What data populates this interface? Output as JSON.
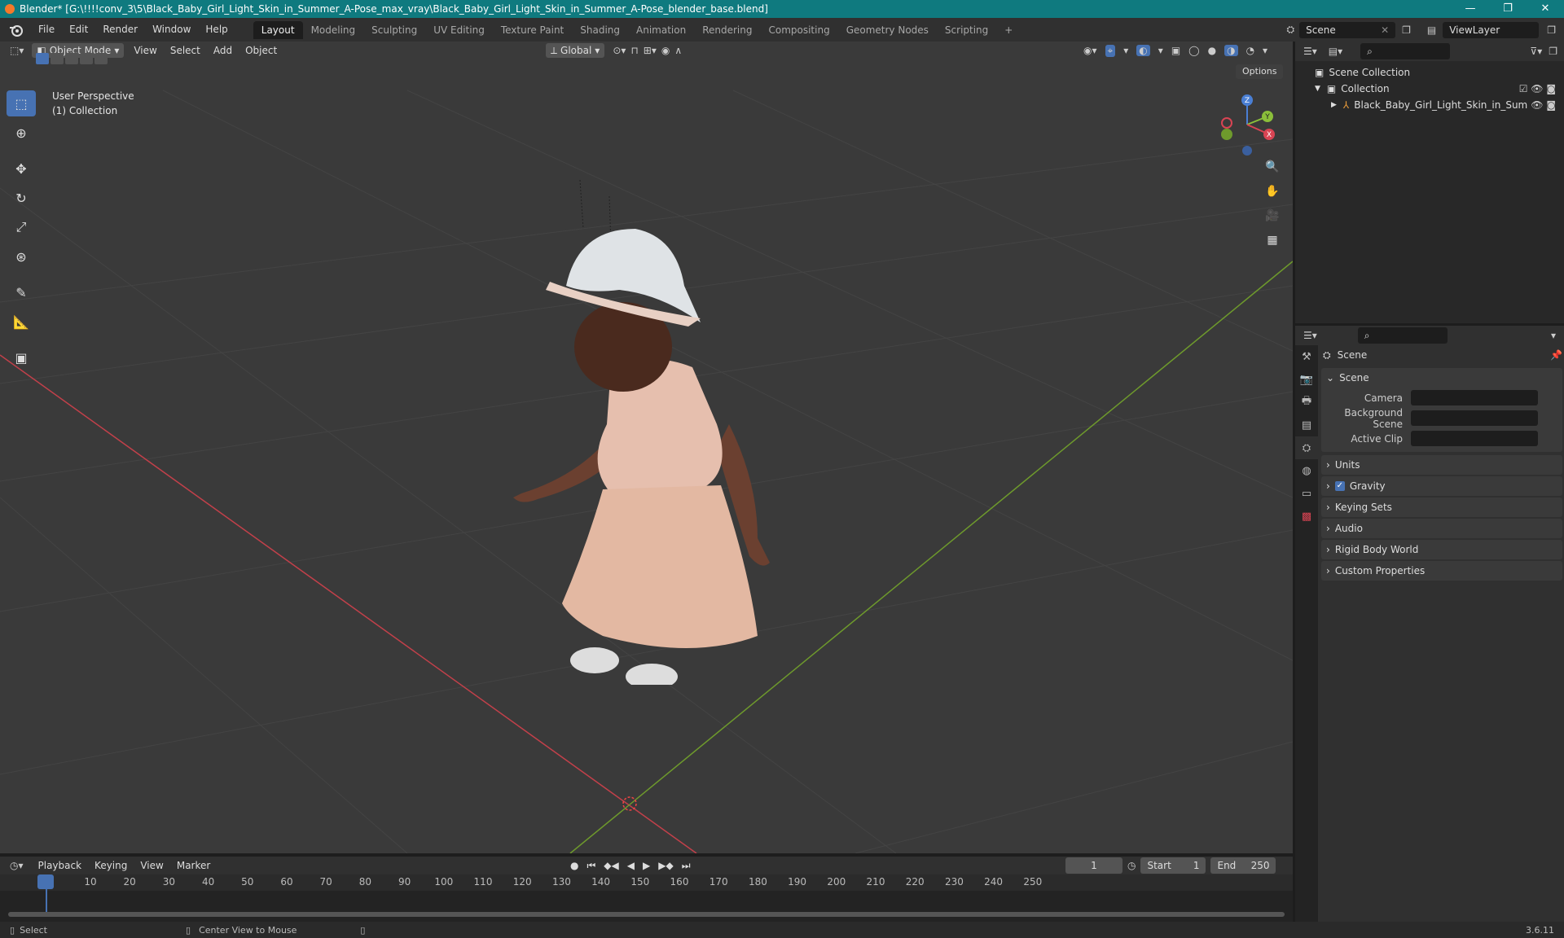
{
  "window": {
    "title": "Blender* [G:\\!!!!conv_3\\5\\Black_Baby_Girl_Light_Skin_in_Summer_A-Pose_max_vray\\Black_Baby_Girl_Light_Skin_in_Summer_A-Pose_blender_base.blend]",
    "minimize": "—",
    "restore": "❐",
    "close": "✕"
  },
  "menu": [
    "File",
    "Edit",
    "Render",
    "Window",
    "Help"
  ],
  "workspaces": [
    "Layout",
    "Modeling",
    "Sculpting",
    "UV Editing",
    "Texture Paint",
    "Shading",
    "Animation",
    "Rendering",
    "Compositing",
    "Geometry Nodes",
    "Scripting"
  ],
  "workspace_add": "+",
  "scene_selector": "Scene",
  "view_layer": "ViewLayer",
  "viewport": {
    "mode": "Object Mode",
    "menus": [
      "View",
      "Select",
      "Add",
      "Object"
    ],
    "orientation": "Global",
    "options": "Options",
    "overlay_line1": "User Perspective",
    "overlay_line2": "(1) Collection",
    "gizmo": {
      "z": "Z",
      "y": "Y",
      "x": "X"
    }
  },
  "outliner": {
    "root": "Scene Collection",
    "collection": "Collection",
    "object": "Black_Baby_Girl_Light_Skin_in_Sum"
  },
  "properties": {
    "header": "Scene",
    "section": "Scene",
    "fields": [
      {
        "label": "Camera"
      },
      {
        "label": "Background Scene"
      },
      {
        "label": "Active Clip"
      }
    ],
    "panels": [
      "Units",
      "Gravity",
      "Keying Sets",
      "Audio",
      "Rigid Body World",
      "Custom Properties"
    ],
    "gravity_checked": true
  },
  "timeline": {
    "menus": [
      "Playback",
      "Keying",
      "View",
      "Marker"
    ],
    "current_frame": "1",
    "start_label": "Start",
    "start": "1",
    "end_label": "End",
    "end": "250",
    "ticks": [
      "1",
      "10",
      "20",
      "30",
      "40",
      "50",
      "60",
      "70",
      "80",
      "90",
      "100",
      "110",
      "120",
      "130",
      "140",
      "150",
      "160",
      "170",
      "180",
      "190",
      "200",
      "210",
      "220",
      "230",
      "240",
      "250"
    ]
  },
  "status": {
    "select": "Select",
    "center": "Center View to Mouse",
    "version": "3.6.11"
  },
  "colors": {
    "titlebar": "#0f7a7f",
    "accent": "#4772b3",
    "x_axis": "#c2404a",
    "y_axis": "#6e9a2c"
  }
}
